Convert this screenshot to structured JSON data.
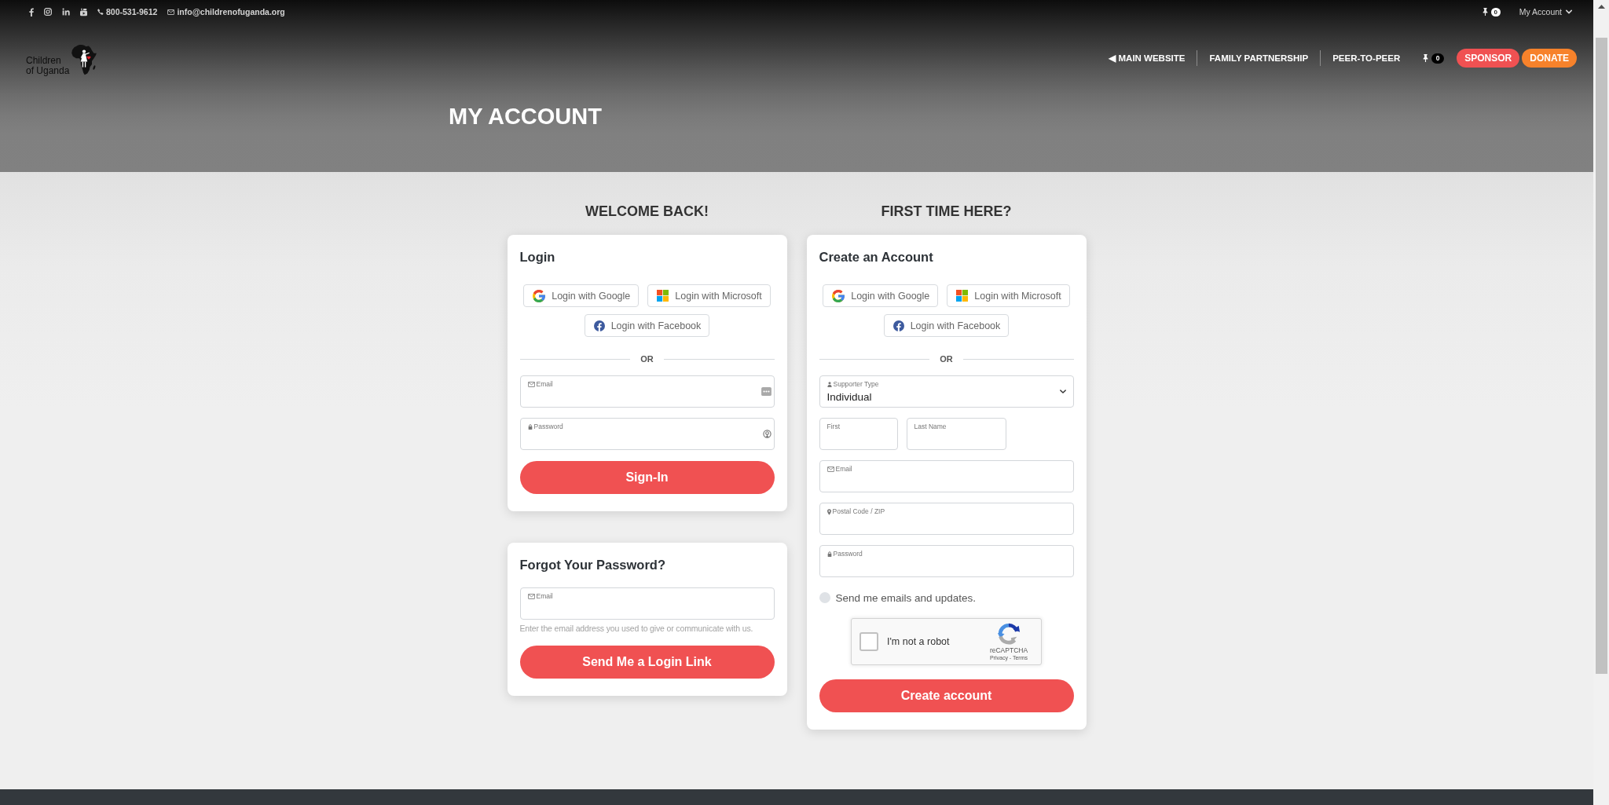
{
  "top_bar": {
    "phone": "800-531-9612",
    "email": "info@childrenofuganda.org",
    "pin_count": "0",
    "account_menu": "My Account"
  },
  "header": {
    "logo_text": [
      "Children",
      "of Uganda"
    ],
    "nav": [
      "◀ MAIN WEBSITE",
      "FAMILY PARTNERSHIP",
      "PEER-TO-PEER"
    ],
    "pin_count": "0",
    "buttons": [
      {
        "label": "SPONSOR",
        "color": "#f05152"
      },
      {
        "label": "DONATE",
        "color": "#f7822b"
      }
    ],
    "title": "MY ACCOUNT"
  },
  "columns": [
    {
      "heading": "WELCOME BACK!",
      "cards": [
        {
          "title": "Login",
          "social_buttons": [
            "Login with Google",
            "Login with Microsoft",
            "Login with Facebook"
          ],
          "divider": "OR",
          "fields": [
            {
              "kind": "email",
              "label": "Email"
            },
            {
              "kind": "password",
              "label": "Password"
            }
          ],
          "submit": "Sign-In"
        },
        {
          "title": "Forgot Your Password?",
          "fields": [
            {
              "kind": "email",
              "label": "Email"
            }
          ],
          "help": "Enter the email address you used to give or communicate with us.",
          "submit": "Send Me a Login Link"
        }
      ]
    },
    {
      "heading": "FIRST TIME HERE?",
      "cards": [
        {
          "title": "Create an Account",
          "social_buttons": [
            "Login with Google",
            "Login with Microsoft",
            "Login with Facebook"
          ],
          "divider": "OR",
          "fields": [
            {
              "kind": "select",
              "label": "Supporter Type",
              "value": "Individual"
            },
            {
              "kind": "name",
              "label": "First"
            },
            {
              "kind": "name",
              "label": "Last Name"
            },
            {
              "kind": "email",
              "label": "Email"
            },
            {
              "kind": "postal",
              "label": "Postal Code / ZIP"
            },
            {
              "kind": "password",
              "label": "Password"
            }
          ],
          "opt_in": {
            "label": "Send me emails and updates.",
            "checked": false
          },
          "captcha": {
            "label": "I'm not a robot",
            "checked": false,
            "brand": "reCAPTCHA",
            "links": "Privacy - Terms"
          },
          "submit": "Create account"
        }
      ]
    }
  ]
}
